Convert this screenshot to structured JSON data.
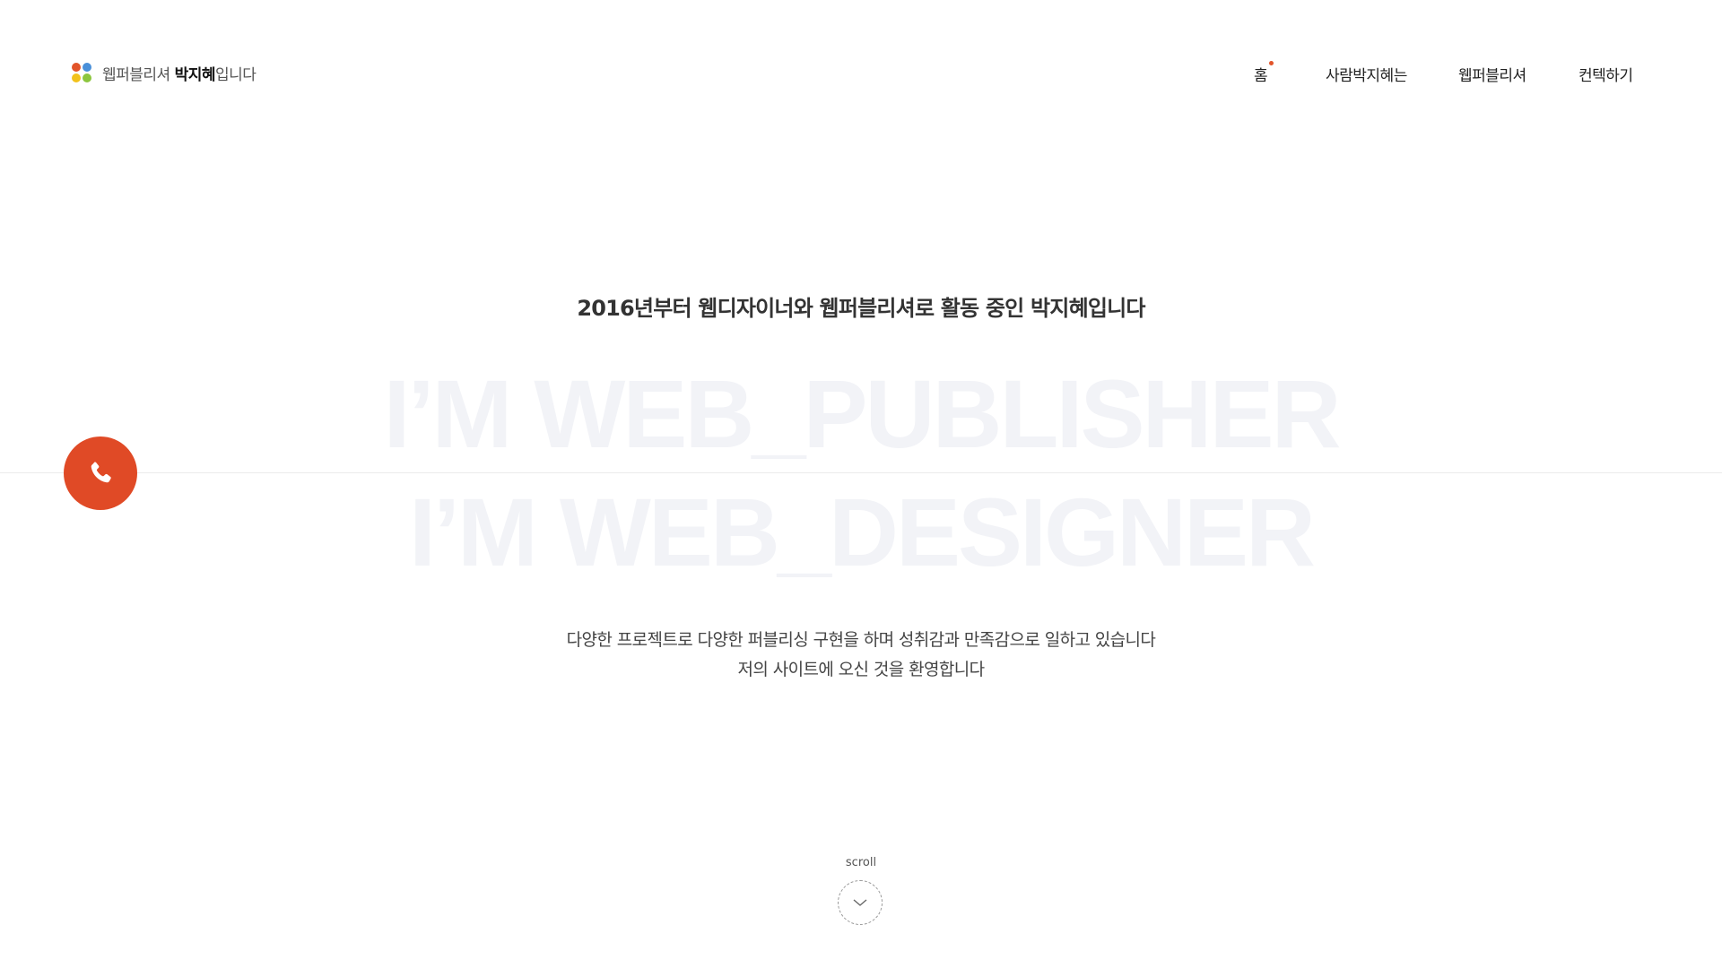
{
  "header": {
    "logo_prefix": "웹퍼블리셔 ",
    "logo_name": "박지혜",
    "logo_suffix": "입니다",
    "logo_colors": [
      "#e2542a",
      "#4a90d9",
      "#f2c21b",
      "#8cc63e"
    ]
  },
  "nav": {
    "items": [
      {
        "label": "홈",
        "active": true
      },
      {
        "label": "사람박지혜는",
        "active": false
      },
      {
        "label": "웹퍼블리셔",
        "active": false
      },
      {
        "label": "컨텍하기",
        "active": false
      }
    ],
    "active_indicator_color": "#e2542a"
  },
  "hero": {
    "title": "2016년부터 웹디자이너와 웹퍼블리셔로 활동 중인 박지혜입니다",
    "bg_text_1": "I’M WEB_PUBLISHER",
    "bg_text_2": "I’M WEB_DESIGNER",
    "description_1": "다양한 프로젝트로 다양한 퍼블리싱 구현을 하며 성취감과 만족감으로 일하고 있습니다",
    "description_2": "저의 사이트에 오신 것을 환영합니다"
  },
  "call_button": {
    "icon": "phone-icon",
    "color": "#e04a26"
  },
  "scroll": {
    "label": "scroll",
    "icon": "chevron-down-icon"
  }
}
